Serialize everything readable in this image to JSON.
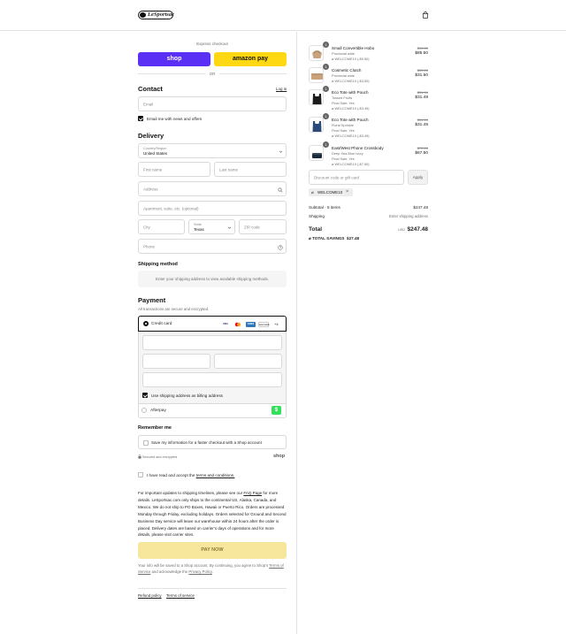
{
  "header": {
    "brand": "LeSportsac"
  },
  "express": {
    "title": "Express checkout",
    "shop_label": "shop",
    "amazon_label": "amazon pay",
    "or_label": "OR"
  },
  "contact": {
    "heading": "Contact",
    "login_label": "Log in",
    "email_placeholder": "Email",
    "news_label": "Email me with news and offers"
  },
  "delivery": {
    "heading": "Delivery",
    "country_label": "Country/Region",
    "country_value": "United States",
    "first_name": "First name",
    "last_name": "Last name",
    "address": "Address",
    "apartment": "Apartment, suite, etc. (optional)",
    "city": "City",
    "state_label": "State",
    "state_value": "Texas",
    "zip": "ZIP code",
    "phone": "Phone"
  },
  "shipping": {
    "heading": "Shipping method",
    "message": "Enter your shipping address to view available shipping methods."
  },
  "payment": {
    "heading": "Payment",
    "subtitle": "All transactions are secure and encrypted.",
    "credit_card_label": "Credit card",
    "card_logos": [
      "VISA",
      "MC",
      "AMEX",
      "DISCOVER"
    ],
    "more_cards": "+4",
    "billing_label": "Use shipping address as billing address",
    "afterpay_label": "Afterpay",
    "afterpay_badge": "$"
  },
  "remember": {
    "heading": "Remember me",
    "save_label": "Save my information for a faster checkout with a Shop account",
    "secure_label": "Secured and encrypted",
    "shop_badge": "shop"
  },
  "terms": {
    "prefix": "I have read and accept the ",
    "link": "terms and conditions."
  },
  "notice": {
    "part1": "For important updates to shipping timelines, please see our ",
    "faq_link": "FAQ Page",
    "part2": " for more details. LeSportsac.com only ships to the continental US, Alaska, Canada, and Mexico. We do not ship to PO Boxes, Hawaii or Puerto Rico. Orders are processed Monday through Friday, excluding holidays. Orders selected for Ground and Second Business Day service will leave our warehouse within 24 hours after the order is placed. Delivery dates are based on carrier’s days of operations and for more details, please visit carrier sites."
  },
  "pay_now": "PAY NOW",
  "shop_note": {
    "part1": "Your info will be saved to a Shop account. By continuing, you agree to Shop’s ",
    "terms_link": "Terms of Service",
    "part2": " and acknowledge the ",
    "privacy_link": "Privacy Policy",
    "part3": "."
  },
  "footer": {
    "refund": "Refund policy",
    "terms": "Terms of service"
  },
  "cart": {
    "items": [
      {
        "qty": "1",
        "name": "Small Convertible Hobo",
        "color": "Provincial wide",
        "extra": "",
        "discount": "WELCOME10 (-$9.50)",
        "old_price": "$95.00",
        "price": "$85.50"
      },
      {
        "qty": "1",
        "name": "Cosmetic Clutch",
        "color": "Provincial wide",
        "extra": "",
        "discount": "WELCOME10 (-$3.50)",
        "old_price": "$35.00",
        "price": "$31.50"
      },
      {
        "qty": "1",
        "name": "Eco Tote with Pouch",
        "color": "Tossed Fruits",
        "extra": "Final Sale: Yes",
        "discount": "WELCOME10 (-$3.49)",
        "old_price": "$34.99",
        "price": "$31.49"
      },
      {
        "qty": "1",
        "name": "Eco Tote with Pouch",
        "color": "Floral Sprinkle",
        "extra": "Final Sale: Yes",
        "discount": "WELCOME10 (-$3.49)",
        "old_price": "$34.99",
        "price": "$31.49"
      },
      {
        "qty": "1",
        "name": "East/West Phone Crossbody",
        "color": "Deep Sea Blue Ivory",
        "extra": "Final Sale: Yes",
        "discount": "WELCOME10 (-$7.50)",
        "old_price": "$75.00",
        "price": "$67.50"
      }
    ],
    "discount_placeholder": "Discount code or gift card",
    "apply_label": "Apply",
    "applied_code": "WELCOME10",
    "subtotal_label": "Subtotal · 5 items",
    "subtotal_value": "$247.48",
    "shipping_label": "Shipping",
    "shipping_value": "Enter shipping address",
    "total_label": "Total",
    "currency": "USD",
    "total_value": "$247.48",
    "savings_label": "TOTAL SAVINGS",
    "savings_value": "$27.48"
  },
  "colors": {
    "shop": "#5a31f4",
    "amazon": "#ffd814",
    "pay_now": "#f6e79c",
    "afterpay": "#32e05c"
  }
}
